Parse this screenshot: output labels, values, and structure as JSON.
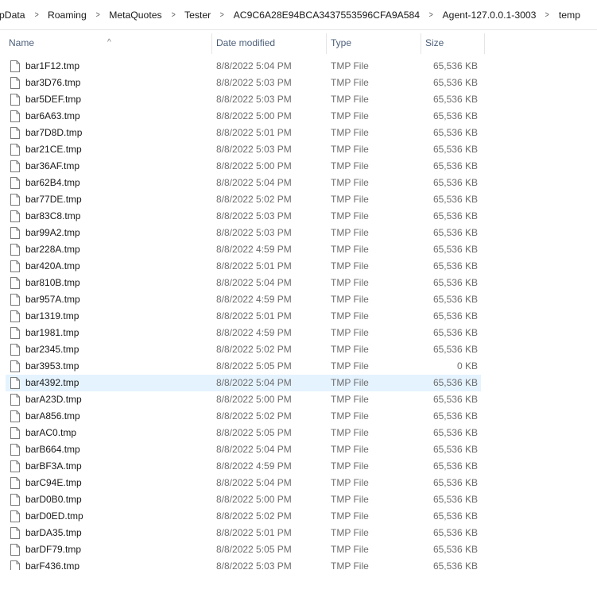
{
  "breadcrumb": [
    "pData",
    "Roaming",
    "MetaQuotes",
    "Tester",
    "AC9C6A28E94BCA3437553596CFA9A584",
    "Agent-127.0.0.1-3003",
    "temp"
  ],
  "columns": {
    "name": "Name",
    "date": "Date modified",
    "type": "Type",
    "size": "Size"
  },
  "icons": {
    "file": "file-icon",
    "separator": "chevron-right-icon",
    "sort": "sort-ascending-icon"
  },
  "selected_index": 19,
  "files": [
    {
      "name": "bar1F12.tmp",
      "date": "8/8/2022 5:04 PM",
      "type": "TMP File",
      "size": "65,536 KB"
    },
    {
      "name": "bar3D76.tmp",
      "date": "8/8/2022 5:03 PM",
      "type": "TMP File",
      "size": "65,536 KB"
    },
    {
      "name": "bar5DEF.tmp",
      "date": "8/8/2022 5:03 PM",
      "type": "TMP File",
      "size": "65,536 KB"
    },
    {
      "name": "bar6A63.tmp",
      "date": "8/8/2022 5:00 PM",
      "type": "TMP File",
      "size": "65,536 KB"
    },
    {
      "name": "bar7D8D.tmp",
      "date": "8/8/2022 5:01 PM",
      "type": "TMP File",
      "size": "65,536 KB"
    },
    {
      "name": "bar21CE.tmp",
      "date": "8/8/2022 5:03 PM",
      "type": "TMP File",
      "size": "65,536 KB"
    },
    {
      "name": "bar36AF.tmp",
      "date": "8/8/2022 5:00 PM",
      "type": "TMP File",
      "size": "65,536 KB"
    },
    {
      "name": "bar62B4.tmp",
      "date": "8/8/2022 5:04 PM",
      "type": "TMP File",
      "size": "65,536 KB"
    },
    {
      "name": "bar77DE.tmp",
      "date": "8/8/2022 5:02 PM",
      "type": "TMP File",
      "size": "65,536 KB"
    },
    {
      "name": "bar83C8.tmp",
      "date": "8/8/2022 5:03 PM",
      "type": "TMP File",
      "size": "65,536 KB"
    },
    {
      "name": "bar99A2.tmp",
      "date": "8/8/2022 5:03 PM",
      "type": "TMP File",
      "size": "65,536 KB"
    },
    {
      "name": "bar228A.tmp",
      "date": "8/8/2022 4:59 PM",
      "type": "TMP File",
      "size": "65,536 KB"
    },
    {
      "name": "bar420A.tmp",
      "date": "8/8/2022 5:01 PM",
      "type": "TMP File",
      "size": "65,536 KB"
    },
    {
      "name": "bar810B.tmp",
      "date": "8/8/2022 5:04 PM",
      "type": "TMP File",
      "size": "65,536 KB"
    },
    {
      "name": "bar957A.tmp",
      "date": "8/8/2022 4:59 PM",
      "type": "TMP File",
      "size": "65,536 KB"
    },
    {
      "name": "bar1319.tmp",
      "date": "8/8/2022 5:01 PM",
      "type": "TMP File",
      "size": "65,536 KB"
    },
    {
      "name": "bar1981.tmp",
      "date": "8/8/2022 4:59 PM",
      "type": "TMP File",
      "size": "65,536 KB"
    },
    {
      "name": "bar2345.tmp",
      "date": "8/8/2022 5:02 PM",
      "type": "TMP File",
      "size": "65,536 KB"
    },
    {
      "name": "bar3953.tmp",
      "date": "8/8/2022 5:05 PM",
      "type": "TMP File",
      "size": "0 KB"
    },
    {
      "name": "bar4392.tmp",
      "date": "8/8/2022 5:04 PM",
      "type": "TMP File",
      "size": "65,536 KB"
    },
    {
      "name": "barA23D.tmp",
      "date": "8/8/2022 5:00 PM",
      "type": "TMP File",
      "size": "65,536 KB"
    },
    {
      "name": "barA856.tmp",
      "date": "8/8/2022 5:02 PM",
      "type": "TMP File",
      "size": "65,536 KB"
    },
    {
      "name": "barAC0.tmp",
      "date": "8/8/2022 5:05 PM",
      "type": "TMP File",
      "size": "65,536 KB"
    },
    {
      "name": "barB664.tmp",
      "date": "8/8/2022 5:04 PM",
      "type": "TMP File",
      "size": "65,536 KB"
    },
    {
      "name": "barBF3A.tmp",
      "date": "8/8/2022 4:59 PM",
      "type": "TMP File",
      "size": "65,536 KB"
    },
    {
      "name": "barC94E.tmp",
      "date": "8/8/2022 5:04 PM",
      "type": "TMP File",
      "size": "65,536 KB"
    },
    {
      "name": "barD0B0.tmp",
      "date": "8/8/2022 5:00 PM",
      "type": "TMP File",
      "size": "65,536 KB"
    },
    {
      "name": "barD0ED.tmp",
      "date": "8/8/2022 5:02 PM",
      "type": "TMP File",
      "size": "65,536 KB"
    },
    {
      "name": "barDA35.tmp",
      "date": "8/8/2022 5:01 PM",
      "type": "TMP File",
      "size": "65,536 KB"
    },
    {
      "name": "barDF79.tmp",
      "date": "8/8/2022 5:05 PM",
      "type": "TMP File",
      "size": "65,536 KB"
    },
    {
      "name": "barF436.tmp",
      "date": "8/8/2022 5:03 PM",
      "type": "TMP File",
      "size": "65,536 KB"
    }
  ]
}
